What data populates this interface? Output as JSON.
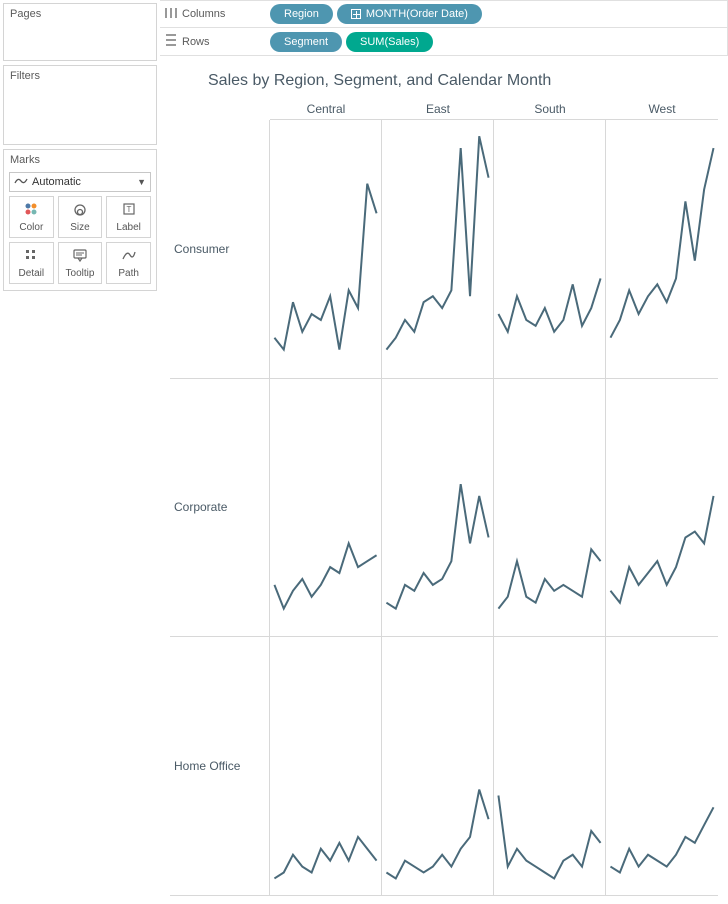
{
  "sidebar": {
    "pages_title": "Pages",
    "filters_title": "Filters",
    "marks_title": "Marks",
    "marks_dropdown": "Automatic",
    "mark_buttons": [
      "Color",
      "Size",
      "Label",
      "Detail",
      "Tooltip",
      "Path"
    ]
  },
  "shelves": {
    "columns_label": "Columns",
    "rows_label": "Rows",
    "col_pills": [
      {
        "label": "Region",
        "kind": "blue"
      },
      {
        "label": "MONTH(Order Date)",
        "kind": "blue",
        "expand": true
      }
    ],
    "row_pills": [
      {
        "label": "Segment",
        "kind": "blue"
      },
      {
        "label": "SUM(Sales)",
        "kind": "teal"
      }
    ]
  },
  "viz": {
    "title": "Sales by Region, Segment, and Calendar Month",
    "col_headers": [
      "Central",
      "East",
      "South",
      "West"
    ],
    "row_headers": [
      "Consumer",
      "Corporate",
      "Home Office"
    ]
  },
  "chart_data": {
    "type": "line",
    "x": [
      1,
      2,
      3,
      4,
      5,
      6,
      7,
      8,
      9,
      10,
      11,
      12
    ],
    "xlabel": "Month of Order Date",
    "ylabel": "SUM(Sales)",
    "ylim": [
      0,
      40000
    ],
    "grid": [
      {
        "row": "Consumer",
        "col": "Central",
        "values": [
          5000,
          3000,
          11000,
          6000,
          9000,
          8000,
          12000,
          3000,
          13000,
          10000,
          31000,
          26000
        ]
      },
      {
        "row": "Consumer",
        "col": "East",
        "values": [
          3000,
          5000,
          8000,
          6000,
          11000,
          12000,
          10000,
          13000,
          37000,
          12000,
          39000,
          32000
        ]
      },
      {
        "row": "Consumer",
        "col": "South",
        "values": [
          9000,
          6000,
          12000,
          8000,
          7000,
          10000,
          6000,
          8000,
          14000,
          7000,
          10000,
          15000
        ]
      },
      {
        "row": "Consumer",
        "col": "West",
        "values": [
          5000,
          8000,
          13000,
          9000,
          12000,
          14000,
          11000,
          15000,
          28000,
          18000,
          30000,
          37000
        ]
      },
      {
        "row": "Corporate",
        "col": "Central",
        "values": [
          7000,
          3000,
          6000,
          8000,
          5000,
          7000,
          10000,
          9000,
          14000,
          10000,
          11000,
          12000
        ]
      },
      {
        "row": "Corporate",
        "col": "East",
        "values": [
          4000,
          3000,
          7000,
          6000,
          9000,
          7000,
          8000,
          11000,
          24000,
          14000,
          22000,
          15000
        ]
      },
      {
        "row": "Corporate",
        "col": "South",
        "values": [
          3000,
          5000,
          11000,
          5000,
          4000,
          8000,
          6000,
          7000,
          6000,
          5000,
          13000,
          11000
        ]
      },
      {
        "row": "Corporate",
        "col": "West",
        "values": [
          6000,
          4000,
          10000,
          7000,
          9000,
          11000,
          7000,
          10000,
          15000,
          16000,
          14000,
          22000
        ]
      },
      {
        "row": "Home Office",
        "col": "Central",
        "values": [
          1000,
          2000,
          5000,
          3000,
          2000,
          6000,
          4000,
          7000,
          4000,
          8000,
          6000,
          4000
        ]
      },
      {
        "row": "Home Office",
        "col": "East",
        "values": [
          2000,
          1000,
          4000,
          3000,
          2000,
          3000,
          5000,
          3000,
          6000,
          8000,
          16000,
          11000
        ]
      },
      {
        "row": "Home Office",
        "col": "South",
        "values": [
          15000,
          3000,
          6000,
          4000,
          3000,
          2000,
          1000,
          4000,
          5000,
          3000,
          9000,
          7000
        ]
      },
      {
        "row": "Home Office",
        "col": "West",
        "values": [
          3000,
          2000,
          6000,
          3000,
          5000,
          4000,
          3000,
          5000,
          8000,
          7000,
          10000,
          13000
        ]
      }
    ]
  }
}
